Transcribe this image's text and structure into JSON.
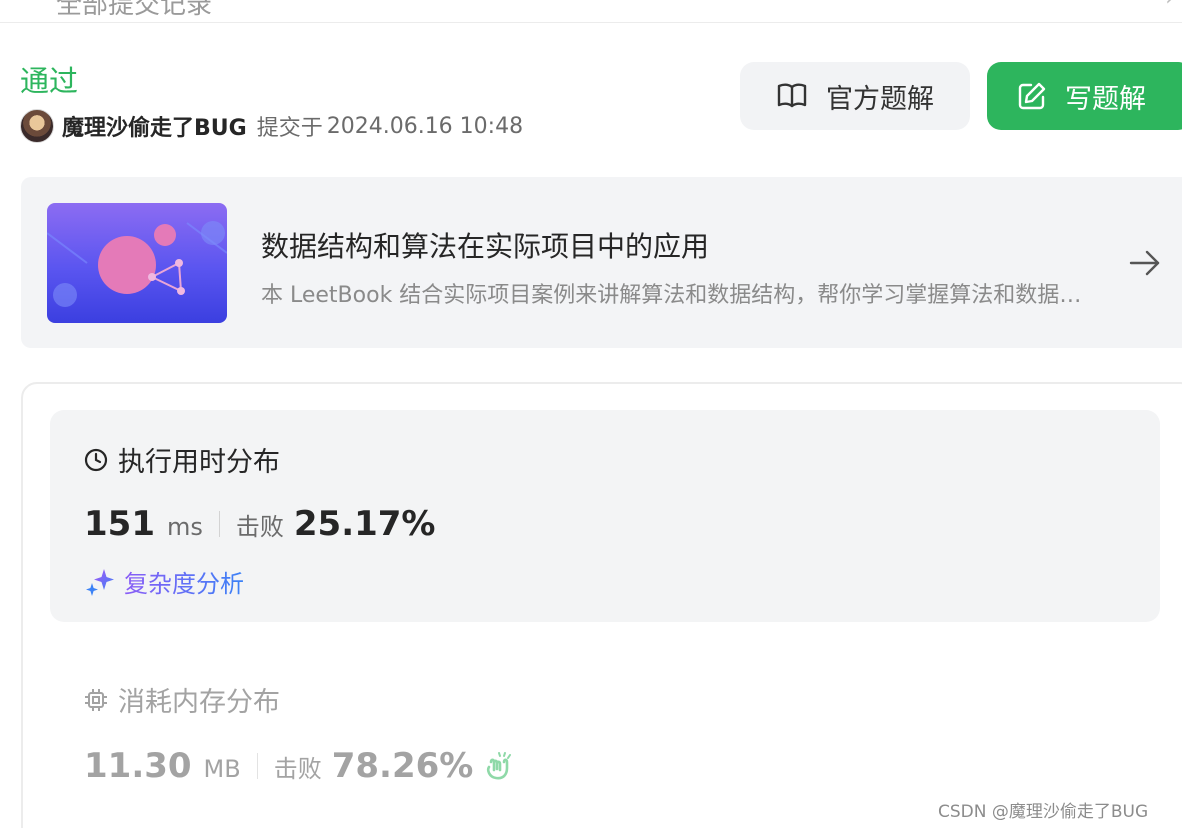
{
  "header": {
    "title": "全部提交记录"
  },
  "submission": {
    "status": "通过",
    "author": "魔理沙偷走了BUG",
    "submitted_label": "提交于",
    "submitted_time": "2024.06.16 10:48"
  },
  "actions": {
    "official_solution": "官方题解",
    "write_solution": "写题解"
  },
  "leetbook": {
    "title": "数据结构和算法在实际项目中的应用",
    "description": "本 LeetBook 结合实际项目案例来讲解算法和数据结构，帮你学习掌握算法和数据结构在实际项目中的应用"
  },
  "runtime": {
    "heading": "执行用时分布",
    "value": "151",
    "unit": "ms",
    "beat_label": "击败",
    "beat_value": "25.17%",
    "complexity_link": "复杂度分析"
  },
  "memory": {
    "heading": "消耗内存分布",
    "value": "11.30",
    "unit": "MB",
    "beat_label": "击败",
    "beat_value": "78.26%"
  },
  "watermark": "CSDN @魔理沙偷走了BUG",
  "colors": {
    "accent_green": "#2db55d",
    "card_bg": "#f3f4f6",
    "muted_text": "#9a9a9a"
  },
  "icons": {
    "book": "open-book-icon",
    "edit": "pencil-edit-icon",
    "arrow": "arrow-right-icon",
    "clock": "clock-icon",
    "sparkle": "sparkle-icon",
    "chip": "chip-icon",
    "clap": "clapping-hands-icon"
  }
}
